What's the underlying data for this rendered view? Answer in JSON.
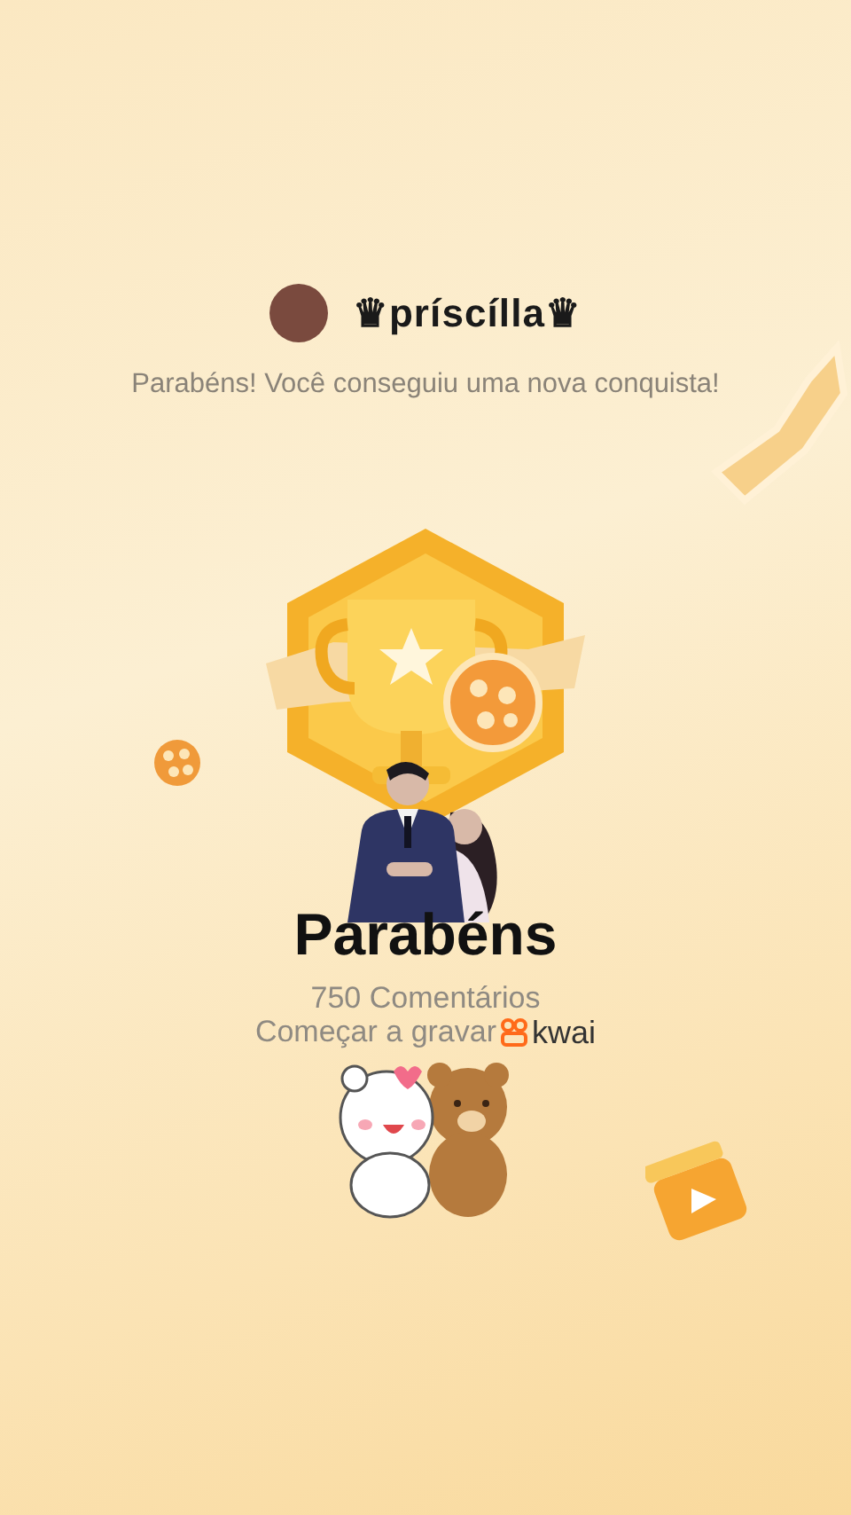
{
  "user": {
    "name": "♛príscílla♛"
  },
  "message": "Parabéns! Você conseguiu uma nova conquista!",
  "title": "Parabéns",
  "achievement": "750 Comentários",
  "cta": {
    "text": "Começar a gravar",
    "brand": "kwai"
  }
}
